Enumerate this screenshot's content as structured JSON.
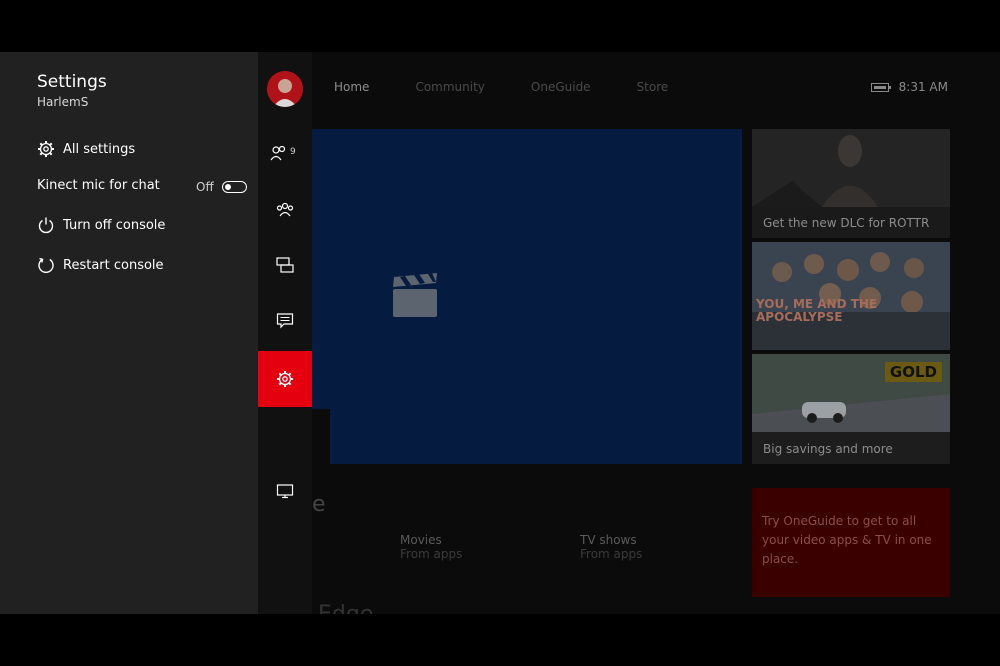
{
  "guide": {
    "title": "Settings",
    "user": "HarlemS",
    "items": [
      {
        "label": "All settings",
        "icon": "gear-icon"
      },
      {
        "label": "Kinect mic for chat",
        "toggle_label": "Off",
        "toggle_on": false
      },
      {
        "label": "Turn off console",
        "icon": "power-icon"
      },
      {
        "label": "Restart console",
        "icon": "restart-icon"
      }
    ]
  },
  "rail": {
    "friends_count": "9",
    "active": "settings",
    "accent": "#e5000f"
  },
  "home": {
    "tabs": [
      "Home",
      "Community",
      "OneGuide",
      "Store"
    ],
    "active_tab": "Home",
    "time": "8:31 AM",
    "tiles": [
      {
        "caption": "Get the new DLC for ROTTR"
      },
      {
        "title_art": "YOU, ME AND THE APOCALYPSE"
      },
      {
        "badge": "GOLD",
        "caption": "Big savings and more"
      },
      {
        "message": "Try OneGuide to get to all your video apps & TV in one place."
      }
    ],
    "pins": [
      {
        "title": "Movies",
        "subtitle": "From apps"
      },
      {
        "title": "TV shows",
        "subtitle": "From apps"
      }
    ],
    "fragments": [
      "e",
      "Edge"
    ]
  },
  "colors": {
    "hero_blue": "#051c40",
    "guide_bg": "#212121"
  }
}
